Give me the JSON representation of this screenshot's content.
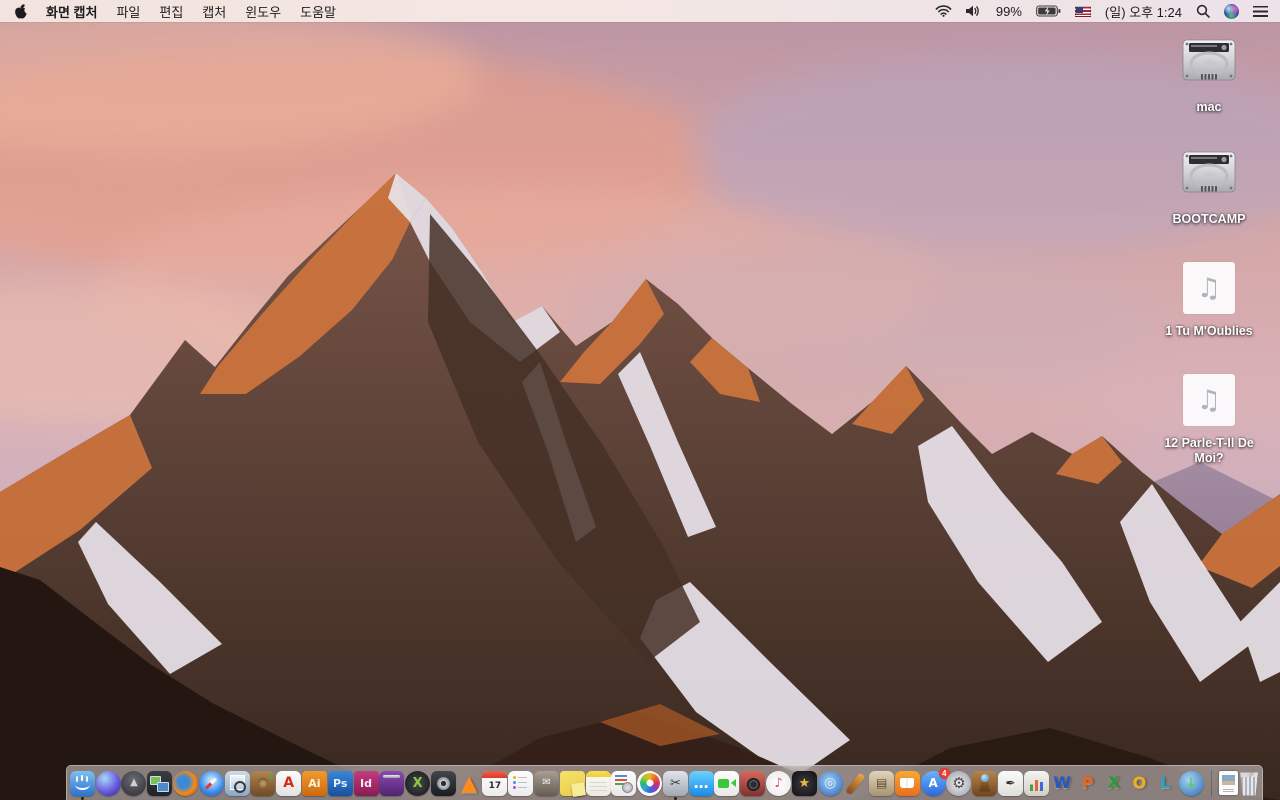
{
  "menu_bar": {
    "apple_menu_icon": "apple-logo",
    "app_name": "화면 캡처",
    "menus": [
      "파일",
      "편집",
      "캡처",
      "윈도우",
      "도움말"
    ],
    "status": {
      "battery_percent": "99%",
      "battery_charging": true,
      "clock": "(일) 오후 1:24",
      "icons": [
        "wifi-icon",
        "volume-icon",
        "battery-icon",
        "us-flag-input-source-icon",
        "spotlight-search-icon",
        "siri-icon",
        "notification-center-icon"
      ]
    }
  },
  "desktop": {
    "audio_glyph": "♫",
    "icons": [
      {
        "name": "mac-volume",
        "label": "mac",
        "type": "drive"
      },
      {
        "name": "bootcamp-volume",
        "label": "BOOTCAMP",
        "type": "drive"
      },
      {
        "name": "music-file-1",
        "label": "1 Tu M'Oublies",
        "type": "audio"
      },
      {
        "name": "music-file-2",
        "label": "12 Parle-T-Il De Moi?",
        "type": "audio"
      }
    ]
  },
  "dock": {
    "trash_full": true,
    "items": [
      {
        "name": "finder",
        "bg": "linear-gradient(180deg,#7ec0f0,#2a72cc)",
        "shape": "rounded",
        "running": true
      },
      {
        "name": "siri",
        "bg": "radial-gradient(circle at 35% 30%,#a8d8f8,#6a5ae0 55%,#2a2a80)",
        "shape": "circle"
      },
      {
        "name": "launchpad",
        "glyph": "▲",
        "fg": "#d0d0d6",
        "size": 10,
        "bg": "radial-gradient(circle at 50% 35%,#6a6a72,#2c2c32)",
        "shape": "circle"
      },
      {
        "name": "mission-control",
        "bg": "linear-gradient(180deg,#3a3e44,#1e2126)",
        "shape": "rounded"
      },
      {
        "name": "firefox",
        "bg": "radial-gradient(circle at 42% 45%,#3a8ad8 28%,#f08a1e 56%,#c04a0a)",
        "shape": "circle"
      },
      {
        "name": "safari",
        "bg": "radial-gradient(circle at 50% 38%,#d8f0fc,#3a8ae8 60%,#1a5ac8)",
        "shape": "circle"
      },
      {
        "name": "preview",
        "bg": "linear-gradient(180deg,#cddbe8,#8aa8c4)",
        "shape": "rounded"
      },
      {
        "name": "contacts",
        "bg": "linear-gradient(180deg,#b0854f,#6f4a28)",
        "shape": "rounded"
      },
      {
        "name": "acrobat-reader",
        "glyph": "A",
        "fg": "#d42a18",
        "size": 14,
        "bg": "linear-gradient(180deg,#fcfcfc,#e4e2e0)",
        "shape": "rounded"
      },
      {
        "name": "illustrator",
        "glyph": "Ai",
        "fg": "#fff4dc",
        "size": 11,
        "bg": "linear-gradient(180deg,#f29a2e,#cc6a0e)",
        "shape": "square"
      },
      {
        "name": "photoshop",
        "glyph": "Ps",
        "fg": "#e0f0ff",
        "size": 11,
        "bg": "linear-gradient(180deg,#3a86d8,#1a4f9e)",
        "shape": "square"
      },
      {
        "name": "indesign",
        "glyph": "Id",
        "fg": "#ffe4f0",
        "size": 11,
        "bg": "linear-gradient(180deg,#c43a80,#861e52)",
        "shape": "square"
      },
      {
        "name": "toast",
        "bg": "linear-gradient(180deg,#8a4ab4,#50246e)",
        "shape": "rounded"
      },
      {
        "name": "xbmc",
        "glyph": "X",
        "fg": "#8ccc3a",
        "size": 13,
        "bg": "radial-gradient(circle,#44484e,#121418)",
        "shape": "circle"
      },
      {
        "name": "disk-fan",
        "bg": "linear-gradient(180deg,#43464c,#1a1c20)",
        "shape": "rounded"
      },
      {
        "name": "vlc",
        "glyph": "▲",
        "fg": "#ff8a1e",
        "size": 21,
        "bg": "transparent",
        "shape": "plain"
      },
      {
        "name": "calendar",
        "glyph": "17",
        "fg": "#2a2a2c",
        "size": 9,
        "bg": "linear-gradient(180deg,#fdfdfd,#ececec)",
        "shape": "rounded"
      },
      {
        "name": "reminders",
        "bg": "linear-gradient(180deg,#fdfdfd,#ececec)",
        "shape": "rounded"
      },
      {
        "name": "mail-press",
        "glyph": "✉",
        "fg": "#f0f0f2",
        "size": 10,
        "bg": "linear-gradient(180deg,#a89e92,#655c52)",
        "shape": "rounded"
      },
      {
        "name": "stickies",
        "bg": "linear-gradient(160deg,#f6e268,#e8cc4a)",
        "shape": "square"
      },
      {
        "name": "notes",
        "bg": "linear-gradient(180deg,#fbfbf6,#eceade)",
        "shape": "rounded"
      },
      {
        "name": "docs-seal",
        "bg": "linear-gradient(180deg,#fcfcfc,#e8e8ea)",
        "shape": "rounded"
      },
      {
        "name": "photos",
        "bg": "#fafafa",
        "shape": "circle"
      },
      {
        "name": "grab",
        "glyph": "✂",
        "fg": "#3c3c40",
        "size": 13,
        "bg": "linear-gradient(180deg,#e0e4ea,#a2a8b2)",
        "shape": "rounded",
        "running": true
      },
      {
        "name": "messages",
        "glyph": "…",
        "fg": "#ffffff",
        "size": 15,
        "bg": "linear-gradient(180deg,#6ad2fc,#1a8ae8)",
        "shape": "rounded"
      },
      {
        "name": "facetime",
        "bg": "linear-gradient(180deg,#fdfdfd,#e8e8e8)",
        "shape": "rounded"
      },
      {
        "name": "photo-booth",
        "bg": "linear-gradient(180deg,#d8685a,#7e3230)",
        "shape": "rounded"
      },
      {
        "name": "itunes",
        "glyph": "♪",
        "fg": "#e84a72",
        "size": 13,
        "bg": "radial-gradient(circle,#ffffff,#e8e8ec)",
        "shape": "circle"
      },
      {
        "name": "imovie",
        "glyph": "★",
        "fg": "#e8be3a",
        "size": 13,
        "bg": "radial-gradient(circle,#3a3a40,#101014)",
        "shape": "rounded"
      },
      {
        "name": "dvd-player",
        "glyph": "◎",
        "fg": "#d8ecfc",
        "size": 14,
        "bg": "radial-gradient(circle at 45% 40%,#9ecef2,#2a62b8)",
        "shape": "circle"
      },
      {
        "name": "garageband",
        "bg": "transparent",
        "shape": "plain"
      },
      {
        "name": "scrapbook",
        "glyph": "▤",
        "fg": "#5c4a32",
        "size": 12,
        "bg": "linear-gradient(180deg,#e0d4bc,#a89470)",
        "shape": "rounded"
      },
      {
        "name": "ibooks",
        "bg": "linear-gradient(180deg,#f8a832,#e86e1e)",
        "shape": "rounded"
      },
      {
        "name": "app-store",
        "glyph": "A",
        "fg": "#ffffff",
        "size": 12,
        "bg": "linear-gradient(180deg,#6ab2f8,#2a6ae0)",
        "shape": "circle",
        "badge": "4"
      },
      {
        "name": "system-preferences",
        "glyph": "⚙",
        "fg": "#4a4a52",
        "size": 15,
        "bg": "radial-gradient(circle,#ececf0,#9a9aa4)",
        "shape": "circle"
      },
      {
        "name": "keynote",
        "bg": "linear-gradient(180deg,#b8834a,#70451e)",
        "shape": "rounded"
      },
      {
        "name": "pages",
        "glyph": "✒",
        "fg": "#2e2e32",
        "size": 12,
        "bg": "linear-gradient(180deg,#fbfbf8,#dededa)",
        "shape": "rounded"
      },
      {
        "name": "numbers",
        "bg": "linear-gradient(180deg,#f4f4f0,#d0d0c8)",
        "shape": "rounded"
      },
      {
        "name": "word",
        "glyph": "W",
        "fg": "#2456c4",
        "size": 16,
        "bg": "transparent",
        "shape": "plain"
      },
      {
        "name": "powerpoint",
        "glyph": "P",
        "fg": "#e8641e",
        "size": 16,
        "bg": "transparent",
        "shape": "plain"
      },
      {
        "name": "excel",
        "glyph": "X",
        "fg": "#2e9a38",
        "size": 16,
        "bg": "transparent",
        "shape": "plain"
      },
      {
        "name": "outlook",
        "glyph": "O",
        "fg": "#f0b018",
        "size": 16,
        "bg": "transparent",
        "shape": "plain"
      },
      {
        "name": "lync",
        "glyph": "L",
        "fg": "#28a2c8",
        "size": 16,
        "bg": "transparent",
        "shape": "plain"
      },
      {
        "name": "downloads-globe",
        "glyph": "↓",
        "fg": "#52d052",
        "size": 13,
        "bg": "radial-gradient(circle at 40% 35%,#a8d4f0,#2a68b0)",
        "shape": "circle"
      },
      {
        "name": "dock-divider",
        "type": "divider"
      },
      {
        "name": "image-file",
        "bg": "",
        "shape": "file"
      },
      {
        "name": "trash",
        "bg": "",
        "shape": "trash"
      }
    ]
  },
  "colors": {
    "menubar_bg": "#f2e3de",
    "dock_bg": "rgba(219,211,211,0.55)",
    "badge_red": "#ec3b2f",
    "label_text": "#ffffff"
  }
}
